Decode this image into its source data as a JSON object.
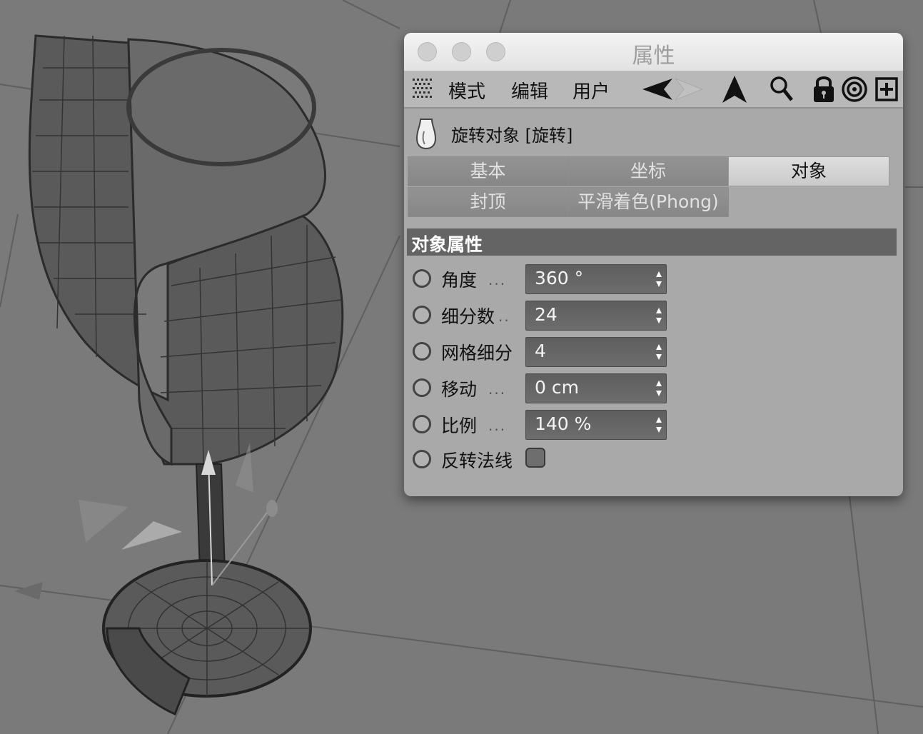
{
  "window": {
    "title": "属性"
  },
  "menubar": {
    "items": [
      "模式",
      "编辑",
      "用户"
    ]
  },
  "object": {
    "title": "旋转对象 [旋转]"
  },
  "tabs": [
    {
      "label": "基本",
      "active": false
    },
    {
      "label": "坐标",
      "active": false
    },
    {
      "label": "对象",
      "active": true
    },
    {
      "label": "封顶",
      "active": false
    },
    {
      "label": "平滑着色(Phong)",
      "active": false
    }
  ],
  "section": {
    "title": "对象属性"
  },
  "params": [
    {
      "label": "角度",
      "dots": "...",
      "value": "360 °"
    },
    {
      "label": "细分数",
      "dots": "..",
      "value": "24"
    },
    {
      "label": "网格细分",
      "dots": "",
      "value": "4"
    },
    {
      "label": "移动",
      "dots": "...",
      "value": "0 cm"
    },
    {
      "label": "比例",
      "dots": "...",
      "value": "140 %"
    }
  ],
  "flip_normals": {
    "label": "反转法线",
    "checked": false
  },
  "colors": {
    "viewport_bg": "#7a7a7a",
    "panel_bg": "#a9a9a9",
    "section_bg": "#646464",
    "field_bg": "#666666"
  }
}
